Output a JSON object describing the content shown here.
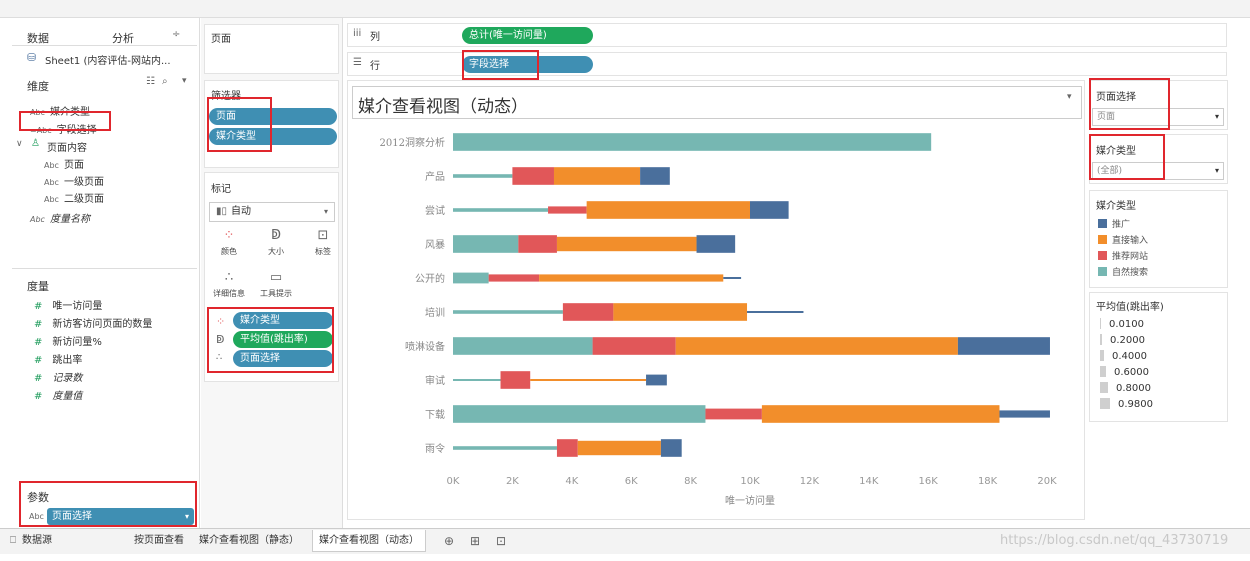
{
  "sidebar": {
    "tab_data": "数据",
    "tab_analysis": "分析",
    "source": "Sheet1 (内容评估-网站内...",
    "dimensions_title": "维度",
    "dimensions": [
      {
        "type": "Abc",
        "label": "媒介类型",
        "x": 30,
        "y": 103
      },
      {
        "type": "=Abc",
        "label": "字段选择",
        "x": 30,
        "y": 121
      },
      {
        "type": "",
        "label": "页面内容",
        "x": 30,
        "y": 139
      },
      {
        "type": "Abc",
        "label": "页面",
        "x": 44,
        "y": 156
      },
      {
        "type": "Abc",
        "label": "一级页面",
        "x": 44,
        "y": 173
      },
      {
        "type": "Abc",
        "label": "二级页面",
        "x": 44,
        "y": 190
      },
      {
        "type": "Abc",
        "label": "度量名称",
        "x": 30,
        "y": 210
      }
    ],
    "measures_title": "度量",
    "measures": [
      {
        "label": "唯一访问量",
        "y": 297
      },
      {
        "label": "新访客访问页面的数量",
        "y": 315
      },
      {
        "label": "新访问量%",
        "y": 333
      },
      {
        "label": "跳出率",
        "y": 351
      },
      {
        "label": "记录数",
        "y": 369
      },
      {
        "label": "度量值",
        "y": 387
      }
    ],
    "params_title": "参数",
    "param_value": "页面选择"
  },
  "shelves": {
    "pages_label": "页面",
    "filters_label": "筛选器",
    "filters": [
      "页面",
      "媒介类型"
    ],
    "marks_label": "标记",
    "mark_type": "自动",
    "mark_buttons": [
      "颜色",
      "大小",
      "标签",
      "详细信息",
      "工具提示"
    ],
    "mark_pills": [
      "媒介类型",
      "平均值(跳出率)",
      "页面选择"
    ],
    "columns_label": "列",
    "columns_pill": "总计(唯一访问量)",
    "rows_label": "行",
    "rows_pill": "字段选择"
  },
  "view": {
    "title": "媒介查看视图（动态）"
  },
  "right_panel": {
    "page_select_title": "页面选择",
    "page_select_value": "页面",
    "media_type_title": "媒介类型",
    "media_type_value": "(全部)",
    "legend_title": "媒介类型",
    "legend": [
      {
        "label": "推广",
        "color": "#4a6f9c"
      },
      {
        "label": "直接输入",
        "color": "#f28e2b"
      },
      {
        "label": "推荐网站",
        "color": "#e15759"
      },
      {
        "label": "自然搜索",
        "color": "#76b7b2"
      }
    ],
    "size_title": "平均值(跳出率)",
    "size_values": [
      "0.0100",
      "0.2000",
      "0.4000",
      "0.6000",
      "0.8000",
      "0.9800"
    ]
  },
  "tabs": [
    "数据源",
    "按页面查看",
    "媒介查看视图（静态）",
    "媒介查看视图（动态）"
  ],
  "watermark": "https://blog.csdn.net/qq_43730719",
  "chart_data": {
    "type": "bar",
    "orientation": "horizontal",
    "stacked": true,
    "xlabel": "唯一访问量",
    "xlim": [
      0,
      20000
    ],
    "xticks": [
      "0K",
      "2K",
      "4K",
      "6K",
      "8K",
      "10K",
      "12K",
      "14K",
      "16K",
      "18K",
      "20K"
    ],
    "categories": [
      "2012洞察分析",
      "产品",
      "尝试",
      "风暴",
      "公开的",
      "培训",
      "喷淋设备",
      "审试",
      "下载",
      "雨令"
    ],
    "series": [
      {
        "name": "自然搜索",
        "color": "#76b7b2",
        "values": [
          16100,
          2000,
          3200,
          2200,
          1200,
          3700,
          4700,
          1600,
          8500,
          3500
        ]
      },
      {
        "name": "推荐网站",
        "color": "#e15759",
        "values": [
          0,
          1400,
          1300,
          1300,
          1700,
          1700,
          2800,
          1000,
          1900,
          700
        ]
      },
      {
        "name": "直接输入",
        "color": "#f28e2b",
        "values": [
          0,
          2900,
          5500,
          4700,
          6200,
          4500,
          9500,
          3900,
          8000,
          2800
        ]
      },
      {
        "name": "推广",
        "color": "#4a6f9c",
        "values": [
          0,
          1000,
          1300,
          1300,
          600,
          1900,
          3100,
          700,
          1700,
          700
        ]
      }
    ],
    "bar_widths": [
      [
        0.98,
        0.98,
        0.98,
        0.98
      ],
      [
        0.2,
        0.98,
        0.98,
        0.98
      ],
      [
        0.2,
        0.4,
        0.98,
        0.98
      ],
      [
        0.98,
        0.98,
        0.8,
        0.98
      ],
      [
        0.6,
        0.4,
        0.4,
        0.1
      ],
      [
        0.2,
        0.98,
        0.98,
        0.1
      ],
      [
        0.98,
        0.98,
        0.98,
        0.98
      ],
      [
        0.1,
        0.98,
        0.1,
        0.6
      ],
      [
        0.98,
        0.6,
        0.98,
        0.4
      ],
      [
        0.2,
        0.98,
        0.8,
        0.98
      ]
    ]
  }
}
